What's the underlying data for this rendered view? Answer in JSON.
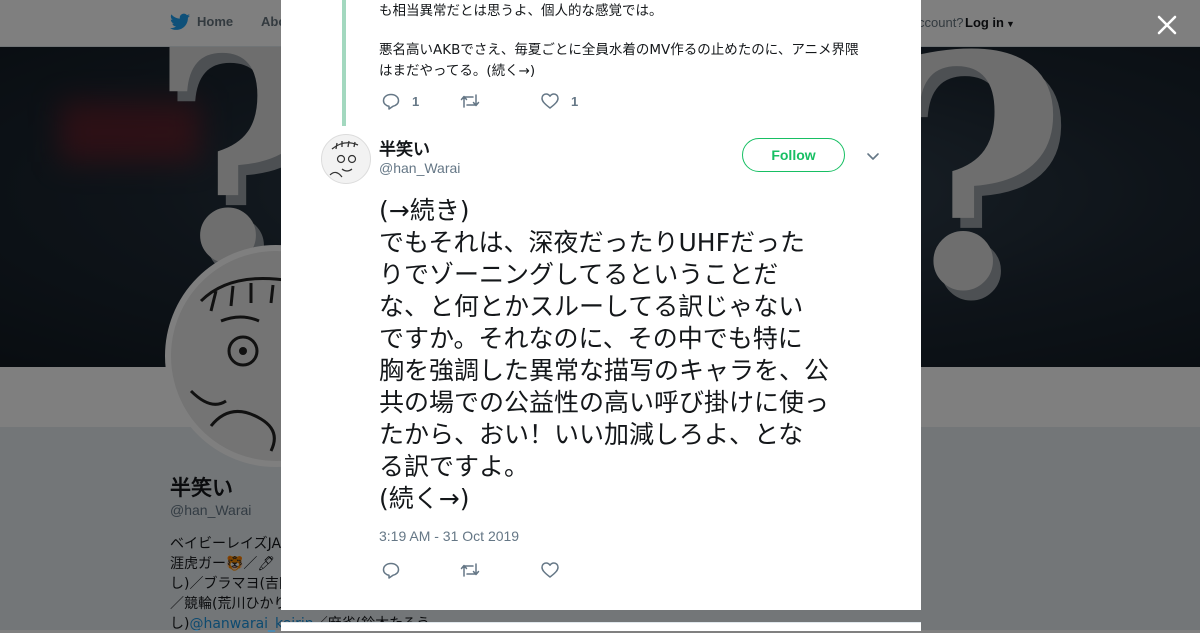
{
  "background_page": {
    "nav": {
      "home_label": "Home",
      "about_label": "Abo",
      "account_prompt": "ccount?",
      "login_label": "Log in"
    },
    "profile": {
      "name": "半笑い",
      "handle": "@han_Warai",
      "bio_lines": [
        "ベイビーレイズJA",
        "涯虎ガー🐯／🖊",
        "し)／ブラマヨ(吉田",
        "／競輪(荒川ひかり",
        "し)",
        "／麻雀(鈴木たろう"
      ],
      "bio_link": "@hanwarai_keirin"
    }
  },
  "previous_tweet": {
    "text_lines": [
      "も相当異常だとは思うよ、個人的な感覚では。",
      "悪名高いAKBでさえ、毎夏ごとに全員水着のMV作るの止めたのに、アニメ界隈",
      "はまだやってる。(続く→)"
    ],
    "reply_count": "1",
    "like_count": "1"
  },
  "tweet": {
    "author_name": "半笑い",
    "author_handle": "@han_Warai",
    "follow_label": "Follow",
    "text_lines": [
      "(→続き)",
      "でもそれは、深夜だったりUHFだった",
      "りでゾーニングしてるということだ",
      "な、と何とかスルーしてる訳じゃない",
      "ですか。それなのに、その中でも特に",
      "胸を強調した異常な描写のキャラを、公",
      "共の場での公益性の高い呼び掛けに使っ",
      "たから、おい！いい加減しろよ、とな",
      "る訳ですよ。",
      "(続く→)"
    ],
    "timestamp": "3:19 AM - 31 Oct 2019"
  },
  "icons": {
    "close": "close-icon",
    "reply": "reply-icon",
    "retweet": "retweet-icon",
    "like": "heart-icon",
    "caret": "chevron-down-icon",
    "bird": "twitter-bird-icon"
  },
  "colors": {
    "follow_green": "#17bf63",
    "thread_line": "#a3d8bf",
    "muted_text": "#657786",
    "link_blue": "#1b95e0"
  }
}
